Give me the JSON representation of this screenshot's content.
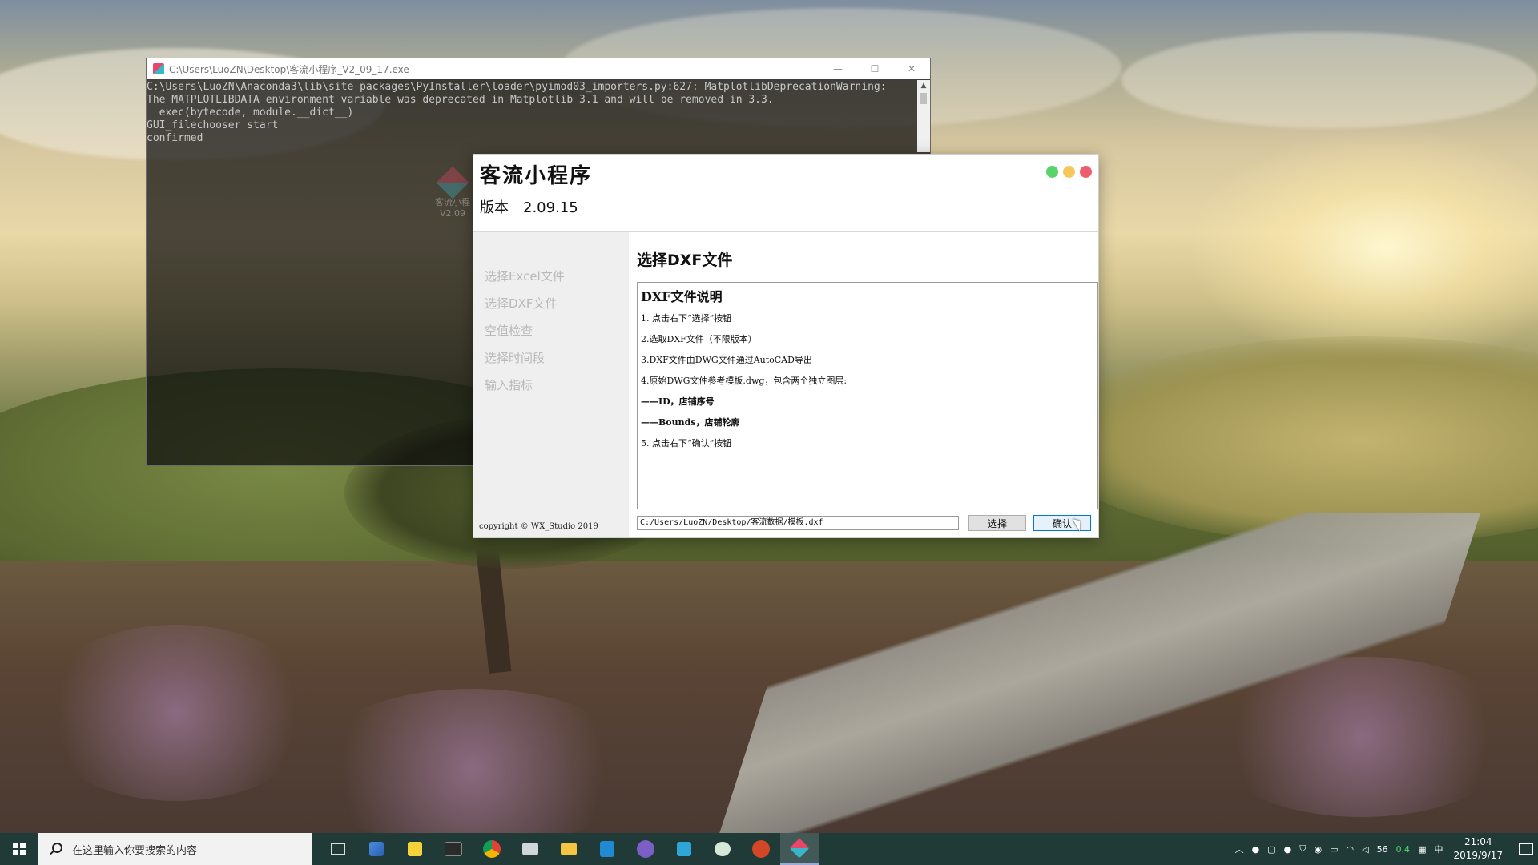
{
  "console": {
    "title": "C:\\Users\\LuoZN\\Desktop\\客流小程序_V2_09_17.exe",
    "minimize": "—",
    "maximize": "☐",
    "close": "✕",
    "output": "C:\\Users\\LuoZN\\Anaconda3\\lib\\site-packages\\PyInstaller\\loader\\pyimod03_importers.py:627: MatplotlibDeprecationWarning:\nThe MATPLOTLIBDATA environment variable was deprecated in Matplotlib 3.1 and will be removed in 3.3.\n  exec(bytecode, module.__dict__)\nGUI_filechooser start\nconfirmed"
  },
  "app": {
    "name": "客流小程序",
    "version_label": "版本",
    "version_value": "2.09.15",
    "sidebar": {
      "items": [
        {
          "label": "选择Excel文件"
        },
        {
          "label": "选择DXF文件"
        },
        {
          "label": "空值检查"
        },
        {
          "label": "选择时间段"
        },
        {
          "label": "输入指标"
        }
      ],
      "copyright": "copyright © WX_Studio 2019"
    },
    "main": {
      "title": "选择DXF文件",
      "doc_heading": "DXF文件说明",
      "doc_lines": [
        "1. 点击右下“选择”按钮",
        "2.选取DXF文件（不限版本）",
        "3.DXF文件由DWG文件通过AutoCAD导出",
        "4.原始DWG文件参考模板.dwg，包含两个独立图层:",
        "——ID，店铺序号",
        "——Bounds，店铺轮廓",
        "5. 点击右下“确认”按钮"
      ],
      "path_value": "C:/Users/LuoZN/Desktop/客流数据/模板.dxf",
      "select_label": "选择",
      "confirm_label": "确认"
    },
    "colors": {
      "dot_green": "#59d46a",
      "dot_yellow": "#f3c95b",
      "dot_red": "#ee5d6c"
    }
  },
  "desktop": {
    "icon_label_line1": "客流小程",
    "icon_label_line2": "V2.09"
  },
  "taskbar": {
    "search_placeholder": "在这里输入你要搜索的内容",
    "pinned": [
      "task-view-icon",
      "network-app-icon",
      "sticky-notes-icon",
      "terminal-icon",
      "chrome-icon",
      "mail-icon",
      "file-explorer-icon",
      "vscode-icon",
      "app-purple-icon",
      "remote-app-icon",
      "wechat-icon",
      "powerpoint-icon",
      "keliu-app-icon"
    ],
    "tray": {
      "badge1": "56",
      "badge2": "0.4",
      "time": "21:04",
      "date": "2019/9/17"
    }
  }
}
